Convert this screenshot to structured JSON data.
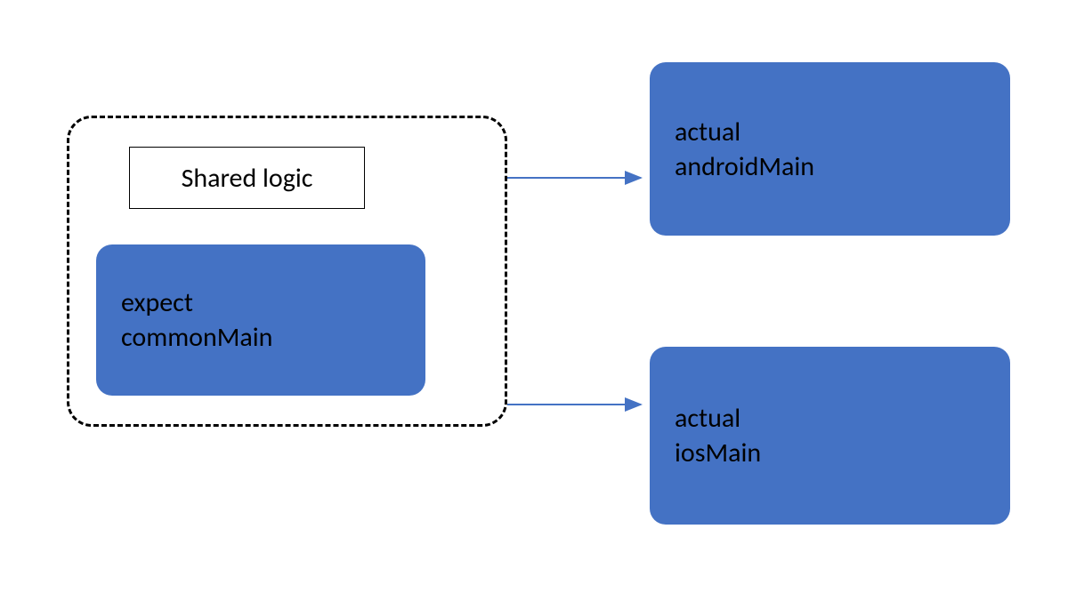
{
  "diagram": {
    "container_label": "Shared logic",
    "common_main": {
      "line1": "expect",
      "line2": "commonMain"
    },
    "android_main": {
      "line1": "actual",
      "line2": "androidMain"
    },
    "ios_main": {
      "line1": "actual",
      "line2": "iosMain"
    }
  },
  "colors": {
    "box_fill": "#4472c4",
    "arrow": "#4472c4",
    "dash_border": "#000000",
    "text": "#000000"
  }
}
